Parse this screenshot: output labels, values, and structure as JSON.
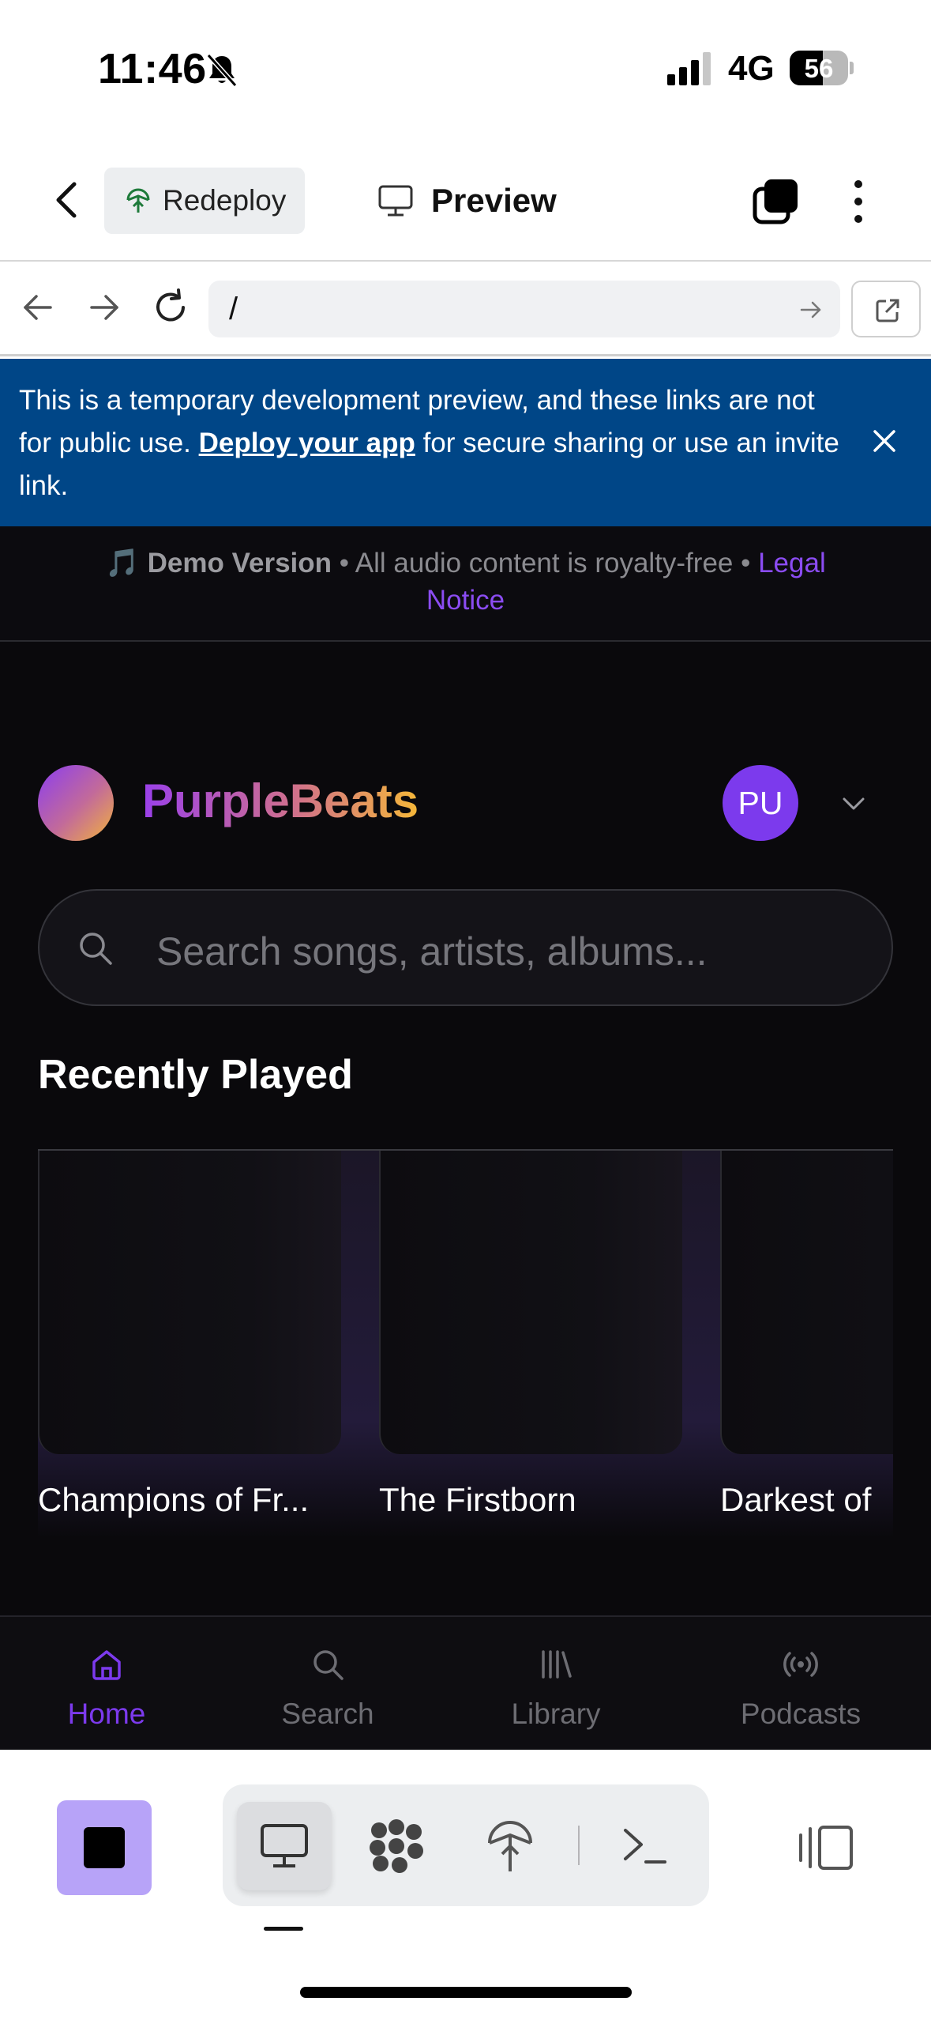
{
  "status_bar": {
    "time": "11:46",
    "network": "4G",
    "battery": "56"
  },
  "header": {
    "redeploy_label": "Redeploy",
    "preview_label": "Preview"
  },
  "browser": {
    "url_path": "/"
  },
  "banner": {
    "text_before": "This is a temporary development preview, and these links are not for public use. ",
    "link_text": "Deploy your app",
    "text_after": " for secure sharing or use an invite link."
  },
  "demo_notice": {
    "emoji": "🎵",
    "title": "Demo Version",
    "text": " • All audio content is royalty-free • ",
    "legal_part1": "Legal",
    "legal_part2": "Notice"
  },
  "app": {
    "brand": "PurpleBeats",
    "avatar_initials": "PU",
    "search_placeholder": "Search songs, artists, albums...",
    "section_title": "Recently Played",
    "recently_played": [
      {
        "title": "Champions of Fr..."
      },
      {
        "title": "The Firstborn"
      },
      {
        "title": "Darkest of"
      }
    ],
    "nav": [
      {
        "label": "Home",
        "icon": "home-icon",
        "active": true
      },
      {
        "label": "Search",
        "icon": "search-icon",
        "active": false
      },
      {
        "label": "Library",
        "icon": "library-icon",
        "active": false
      },
      {
        "label": "Podcasts",
        "icon": "podcast-icon",
        "active": false
      }
    ]
  },
  "colors": {
    "accent_purple": "#7c3aed",
    "banner_blue": "#004687",
    "app_background": "#0a090c",
    "stop_button": "#b7a3f8"
  }
}
